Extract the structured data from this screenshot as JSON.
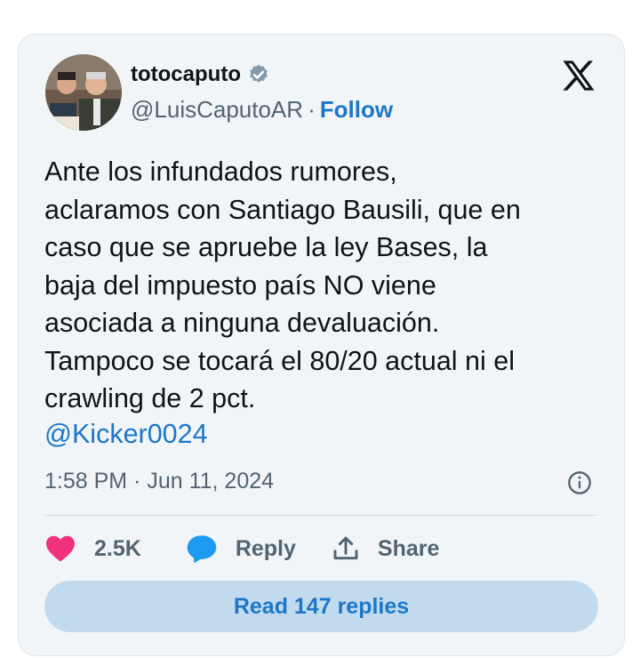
{
  "tweet": {
    "display_name": "totocaputo",
    "handle": "@LuisCaputoAR",
    "separator": "·",
    "follow_label": "Follow",
    "text": "Ante los infundados rumores,\naclaramos con Santiago Bausili, que en\ncaso que se apruebe la ley Bases, la\nbaja del impuesto país NO viene\nasociada a ninguna devaluación.\nTampoco se tocará el 80/20 actual ni el\ncrawling de 2 pct.",
    "mention": "@Kicker0024",
    "timestamp": "1:58 PM · Jun 11, 2024",
    "like_count": "2.5K",
    "reply_label": "Reply",
    "share_label": "Share",
    "read_replies_label": "Read 147 replies"
  },
  "icons": {
    "verified": "verified-badge-icon",
    "platform": "x-logo-icon",
    "info": "info-icon",
    "like": "heart-icon",
    "reply": "speech-bubble-icon",
    "share": "share-upload-icon"
  },
  "colors": {
    "card_background": "#f1f5f8",
    "link": "#1d77c9",
    "heart": "#f0317b",
    "reply_bubble": "#1d9bf0",
    "button_background": "#c2daee",
    "secondary_text": "#536471"
  }
}
